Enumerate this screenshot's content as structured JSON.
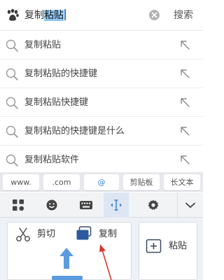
{
  "search": {
    "query_prefix": "复制",
    "query_selected": "粘贴",
    "button": "搜索"
  },
  "suggestions": [
    "复制粘贴",
    "复制粘贴的快捷键",
    "复制粘贴快捷键",
    "复制粘贴的快捷键是什么",
    "复制粘贴软件"
  ],
  "shortcuts": [
    "www.",
    ".com",
    "@",
    "剪贴板",
    "长文本"
  ],
  "edit_panel": {
    "cut": "剪切",
    "copy": "复制",
    "paste": "粘贴"
  },
  "colors": {
    "accent": "#3a7fd5",
    "selection": "#8fc7f2",
    "annotation_arrow": "#d23a2f"
  }
}
